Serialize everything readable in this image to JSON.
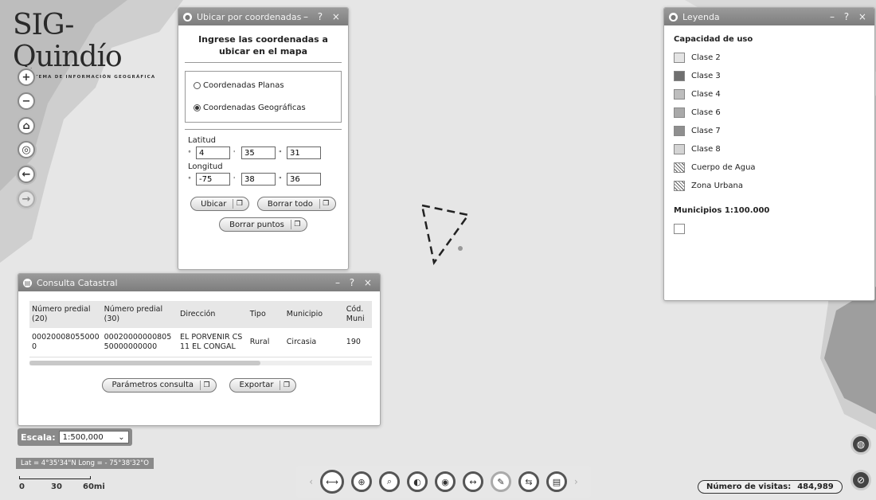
{
  "logo": {
    "brand": "SIG-Quindío",
    "tagline": "SISTEMA DE INFORMACIÓN GEOGRÁFICA"
  },
  "nav": [
    {
      "name": "zoom-in-button",
      "glyph": "+"
    },
    {
      "name": "zoom-out-button",
      "glyph": "−"
    },
    {
      "name": "home-button",
      "glyph": "⌂"
    },
    {
      "name": "locate-button",
      "glyph": "◎"
    },
    {
      "name": "back-button",
      "glyph": "←"
    },
    {
      "name": "forward-button",
      "glyph": "→"
    }
  ],
  "coord_panel": {
    "title": "Ubicar por coordenadas",
    "controls": "– ? ×",
    "heading": "Ingrese las coordenadas a ubicar en el mapa",
    "option_planas": "Coordenadas Planas",
    "option_geograficas": "Coordenadas Geográficas",
    "selected": "geograficas",
    "lat_label": "Latitud",
    "lon_label": "Longitud",
    "lat": {
      "deg": "4",
      "min": "35",
      "sec": "31"
    },
    "lon": {
      "deg": "-75",
      "min": "38",
      "sec": "36"
    },
    "btn_ubicar": "Ubicar",
    "btn_borrar_todo": "Borrar todo",
    "btn_borrar_puntos": "Borrar puntos"
  },
  "catastral": {
    "title": "Consulta Catastral",
    "controls": "– ? ×",
    "columns": [
      "Número predial (20)",
      "Número predial (30)",
      "Dirección",
      "Tipo",
      "Municipio",
      "Cód. Muni"
    ],
    "row": [
      "00020008055000 0",
      "00020000000805 50000000000",
      "EL PORVENIR CS 11 EL CONGAL",
      "Rural",
      "Circasia",
      "190"
    ],
    "btn_parametros": "Parámetros consulta",
    "btn_exportar": "Exportar"
  },
  "legend": {
    "title": "Leyenda",
    "controls": "– ? ×",
    "section1": "Capacidad de uso",
    "items": [
      {
        "label": "Clase 2",
        "color": "#e4e4e4",
        "pattern": "solid"
      },
      {
        "label": "Clase 3",
        "color": "#6f6f6f",
        "pattern": "solid"
      },
      {
        "label": "Clase 4",
        "color": "#bdbdbd",
        "pattern": "solid"
      },
      {
        "label": "Clase 6",
        "color": "#a9a9a9",
        "pattern": "solid"
      },
      {
        "label": "Clase 7",
        "color": "#8f8f8f",
        "pattern": "solid"
      },
      {
        "label": "Clase 8",
        "color": "#d4d4d4",
        "pattern": "solid"
      },
      {
        "label": "Cuerpo de Agua",
        "color": "#ffffff",
        "pattern": "hatch"
      },
      {
        "label": "Zona Urbana",
        "color": "#ffffff",
        "pattern": "hatch"
      }
    ],
    "section2": "Municipios 1:100.000"
  },
  "escala": {
    "label": "Escala:",
    "value": "1:500,000"
  },
  "coord_readout": "Lat = 4°35'34\"N Long = - 75°38'32\"O",
  "scalebar": {
    "labels": [
      "0",
      "30",
      "60mi"
    ]
  },
  "toolbar": {
    "tools": [
      "measure-tool",
      "zoom-box-tool",
      "search-tool",
      "layers-tool",
      "identify-tool",
      "pan-tool",
      "draw-tool",
      "swipe-tool",
      "print-tool"
    ]
  },
  "visitas": {
    "label": "Número de visitas:",
    "count": "484,989"
  }
}
